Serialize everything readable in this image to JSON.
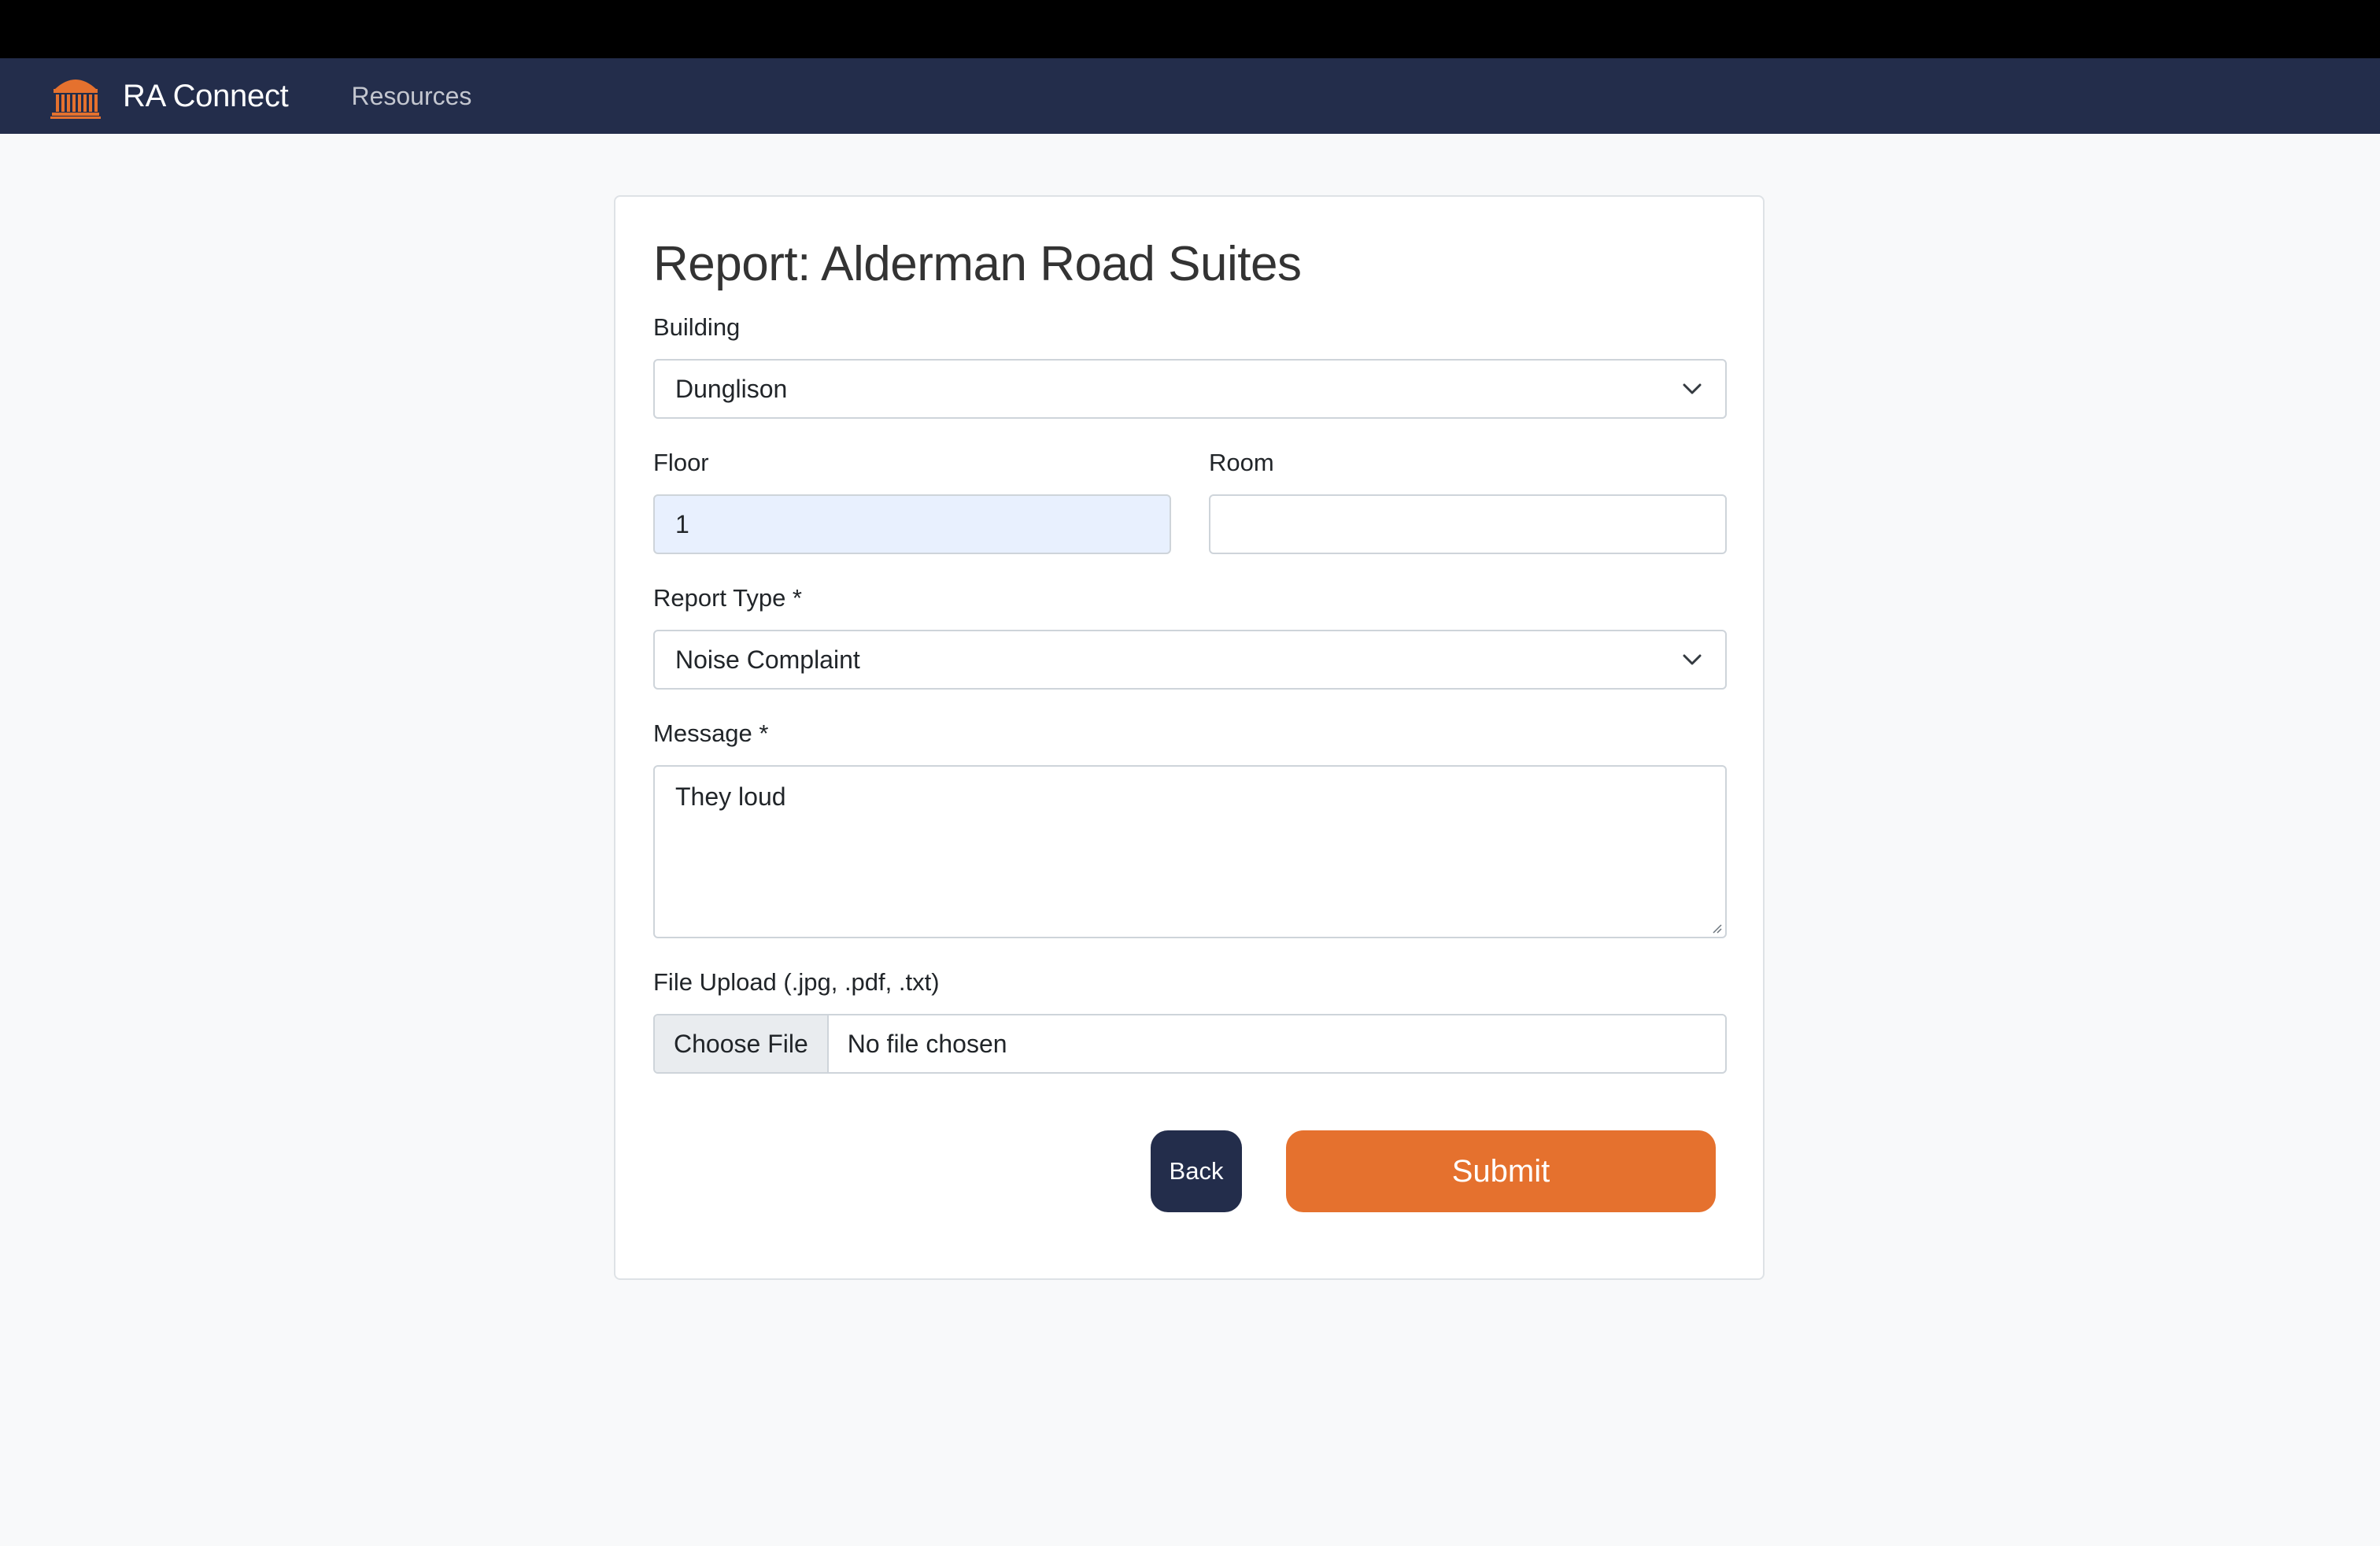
{
  "navbar": {
    "brand_icon": "rotunda-logo-icon",
    "brand": "RA Connect",
    "links": [
      "Resources"
    ]
  },
  "colors": {
    "navbar": "#232d4b",
    "accent": "#e5712e",
    "back_button": "#232d4b",
    "page_background": "#f8f9fa"
  },
  "form": {
    "title": "Report: Alderman Road Suites",
    "building": {
      "label": "Building",
      "selected": "Dunglison"
    },
    "floor": {
      "label": "Floor",
      "value": "1"
    },
    "room": {
      "label": "Room",
      "value": ""
    },
    "report_type": {
      "label": "Report Type *",
      "selected": "Noise Complaint"
    },
    "message": {
      "label": "Message *",
      "value": "They loud"
    },
    "file_upload": {
      "label": "File Upload (.jpg, .pdf, .txt)",
      "button": "Choose File",
      "status": "No file chosen"
    },
    "buttons": {
      "back": "Back",
      "submit": "Submit"
    }
  }
}
